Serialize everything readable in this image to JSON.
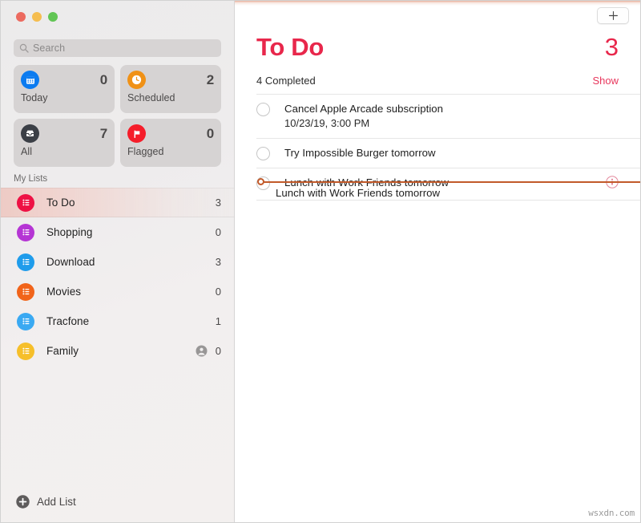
{
  "window": {
    "traffic_lights": [
      {
        "name": "close",
        "color": "#ec6a5f"
      },
      {
        "name": "minimize",
        "color": "#f5bd4f"
      },
      {
        "name": "maximize",
        "color": "#61c554"
      }
    ]
  },
  "sidebar": {
    "search": {
      "placeholder": "Search",
      "icon": "search-icon",
      "value": ""
    },
    "smart_lists": [
      {
        "label": "Today",
        "count": "0",
        "icon": "calendar-icon",
        "color": "#0b7bf0"
      },
      {
        "label": "Scheduled",
        "count": "2",
        "icon": "clock-icon",
        "color": "#f09116"
      },
      {
        "label": "All",
        "count": "7",
        "icon": "tray-icon",
        "color": "#3b3f46"
      },
      {
        "label": "Flagged",
        "count": "0",
        "icon": "flag-icon",
        "color": "#f51d2a"
      }
    ],
    "section_header": "My Lists",
    "lists": [
      {
        "label": "To Do",
        "count": "3",
        "color": "#ee1144",
        "selected": true,
        "shared": false
      },
      {
        "label": "Shopping",
        "count": "0",
        "color": "#b535d4",
        "selected": false,
        "shared": false
      },
      {
        "label": "Download",
        "count": "3",
        "color": "#1f9ceb",
        "selected": false,
        "shared": false
      },
      {
        "label": "Movies",
        "count": "0",
        "color": "#f1641a",
        "selected": false,
        "shared": false
      },
      {
        "label": "Tracfone",
        "count": "1",
        "color": "#3aa9f2",
        "selected": false,
        "shared": false
      },
      {
        "label": "Family",
        "count": "0",
        "color": "#f6bf2a",
        "selected": false,
        "shared": true
      }
    ],
    "add_list": {
      "label": "Add List",
      "icon": "plus-circle-icon"
    }
  },
  "main": {
    "add_task_button": {
      "icon": "plus-icon"
    },
    "title": "To Do",
    "total_count": "3",
    "accent_color": "#e8274b",
    "completed_label": "4 Completed",
    "show_link": "Show",
    "tasks": [
      {
        "title": "Cancel Apple Arcade subscription",
        "subtitle": "10/23/19, 3:00 PM",
        "has_info": false
      },
      {
        "title": "Try Impossible Burger tomorrow",
        "subtitle": "",
        "has_info": false
      },
      {
        "title": "Lunch with Work Friends tomorrow",
        "subtitle": "",
        "has_info": true
      }
    ],
    "drag": {
      "ghost_text": "Lunch with Work Friends tomorrow",
      "indicator_color": "#c25a2a"
    },
    "info_icon": "info-circle-icon"
  },
  "watermark": "wsxdn.com"
}
